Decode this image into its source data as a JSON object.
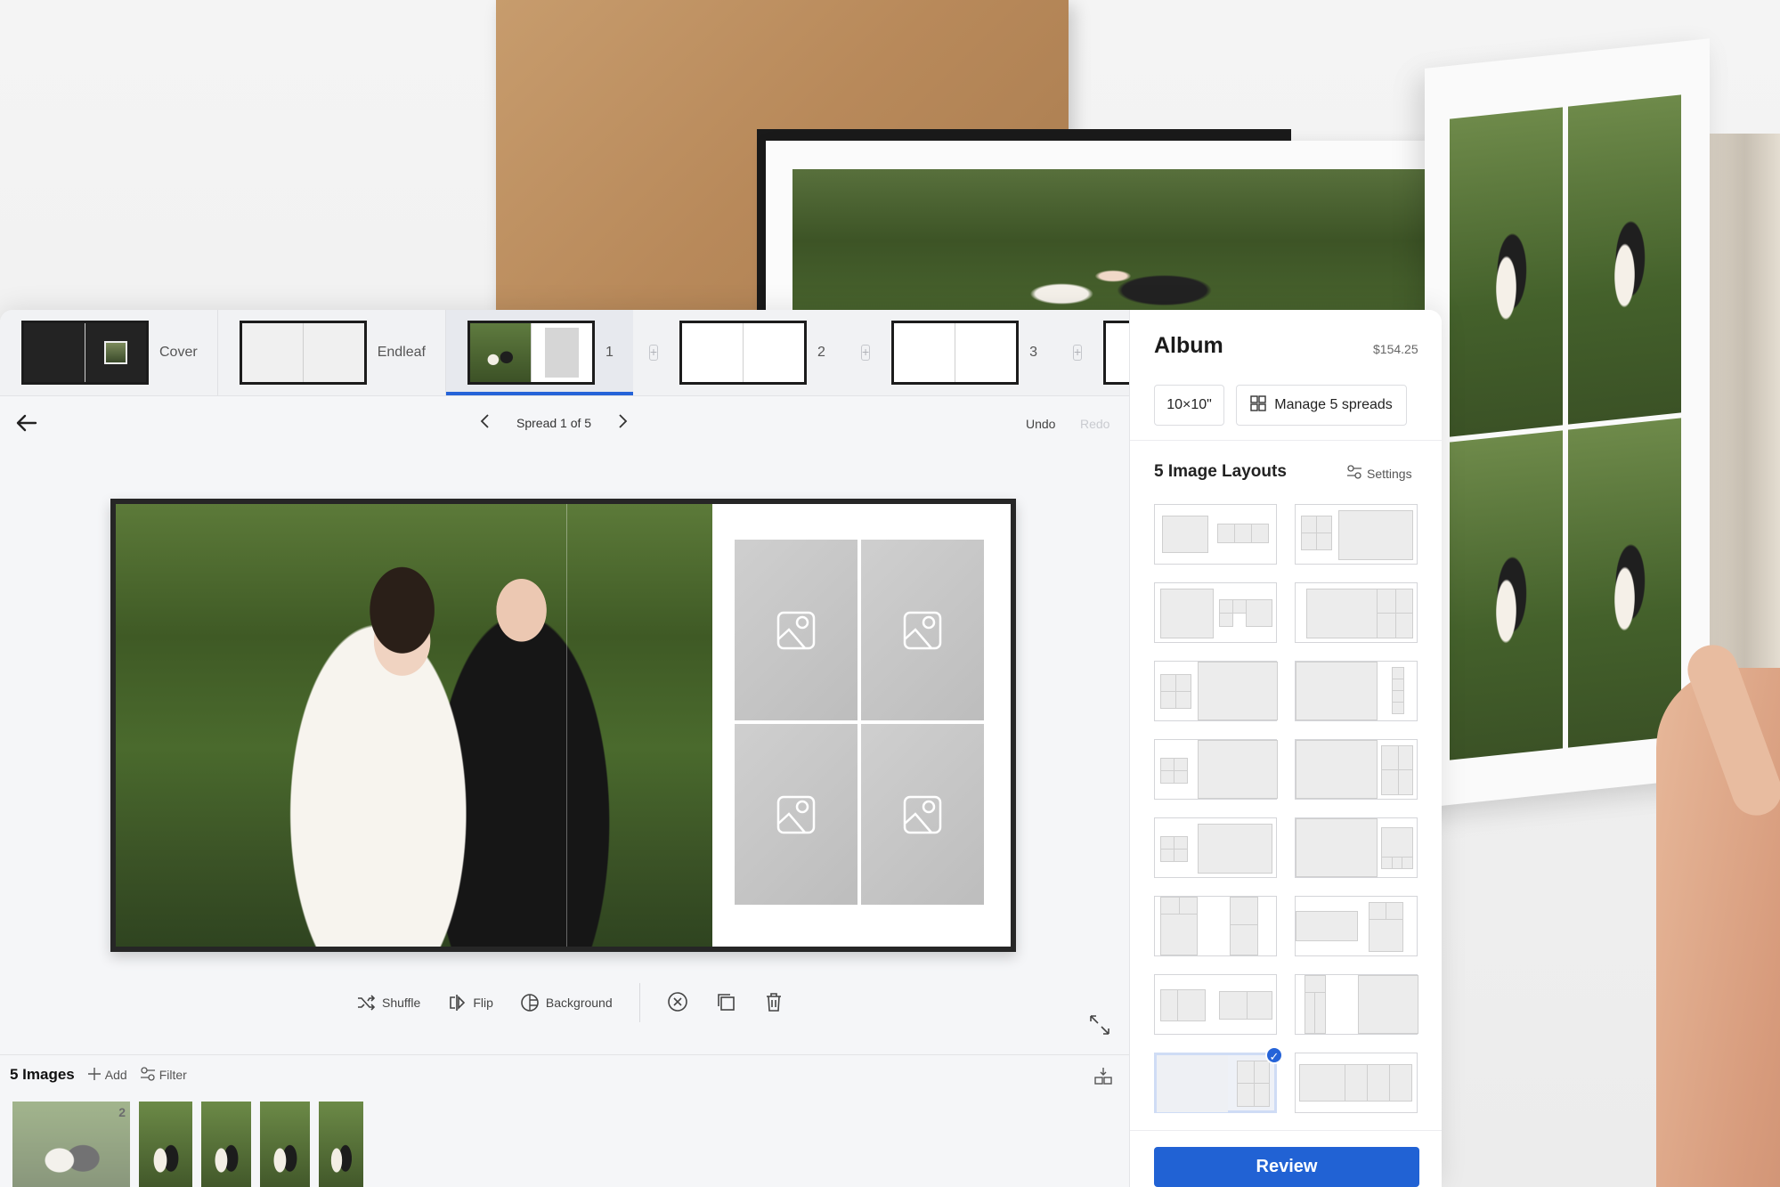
{
  "colors": {
    "accent": "#2563d8",
    "review_button": "#2162d4",
    "panel_bg": "#ffffff",
    "editor_bg": "#f5f6f8"
  },
  "spread_strip": {
    "items": [
      {
        "label": "Cover",
        "type": "cover"
      },
      {
        "label": "Endleaf",
        "type": "endleaf"
      },
      {
        "label": "1",
        "type": "photo",
        "active": true
      },
      {
        "label": "2",
        "type": "blank"
      },
      {
        "label": "3",
        "type": "blank"
      }
    ],
    "add_icon": "plus-icon"
  },
  "editor": {
    "back_icon": "arrow-left-icon",
    "spread_indicator": "Spread 1 of 5",
    "prev_icon": "chevron-left-icon",
    "next_icon": "chevron-right-icon",
    "undo_label": "Undo",
    "redo_label": "Redo"
  },
  "actions": {
    "shuffle_label": "Shuffle",
    "flip_label": "Flip",
    "background_label": "Background",
    "clear_icon": "circle-x-icon",
    "duplicate_icon": "copy-icon",
    "delete_icon": "trash-icon",
    "expand_icon": "collapse-arrows-icon"
  },
  "tray": {
    "title": "5 Images",
    "add_label": "Add",
    "filter_label": "Filter",
    "first_count": "2",
    "tool_icon": "arrange-icon"
  },
  "panel": {
    "title": "Album",
    "price": "$154.25",
    "size_label": "10×10\"",
    "manage_label": "Manage 5 spreads",
    "layouts_title": "5 Image Layouts",
    "settings_label": "Settings",
    "selected_layout_index": 14,
    "review_label": "Review"
  }
}
